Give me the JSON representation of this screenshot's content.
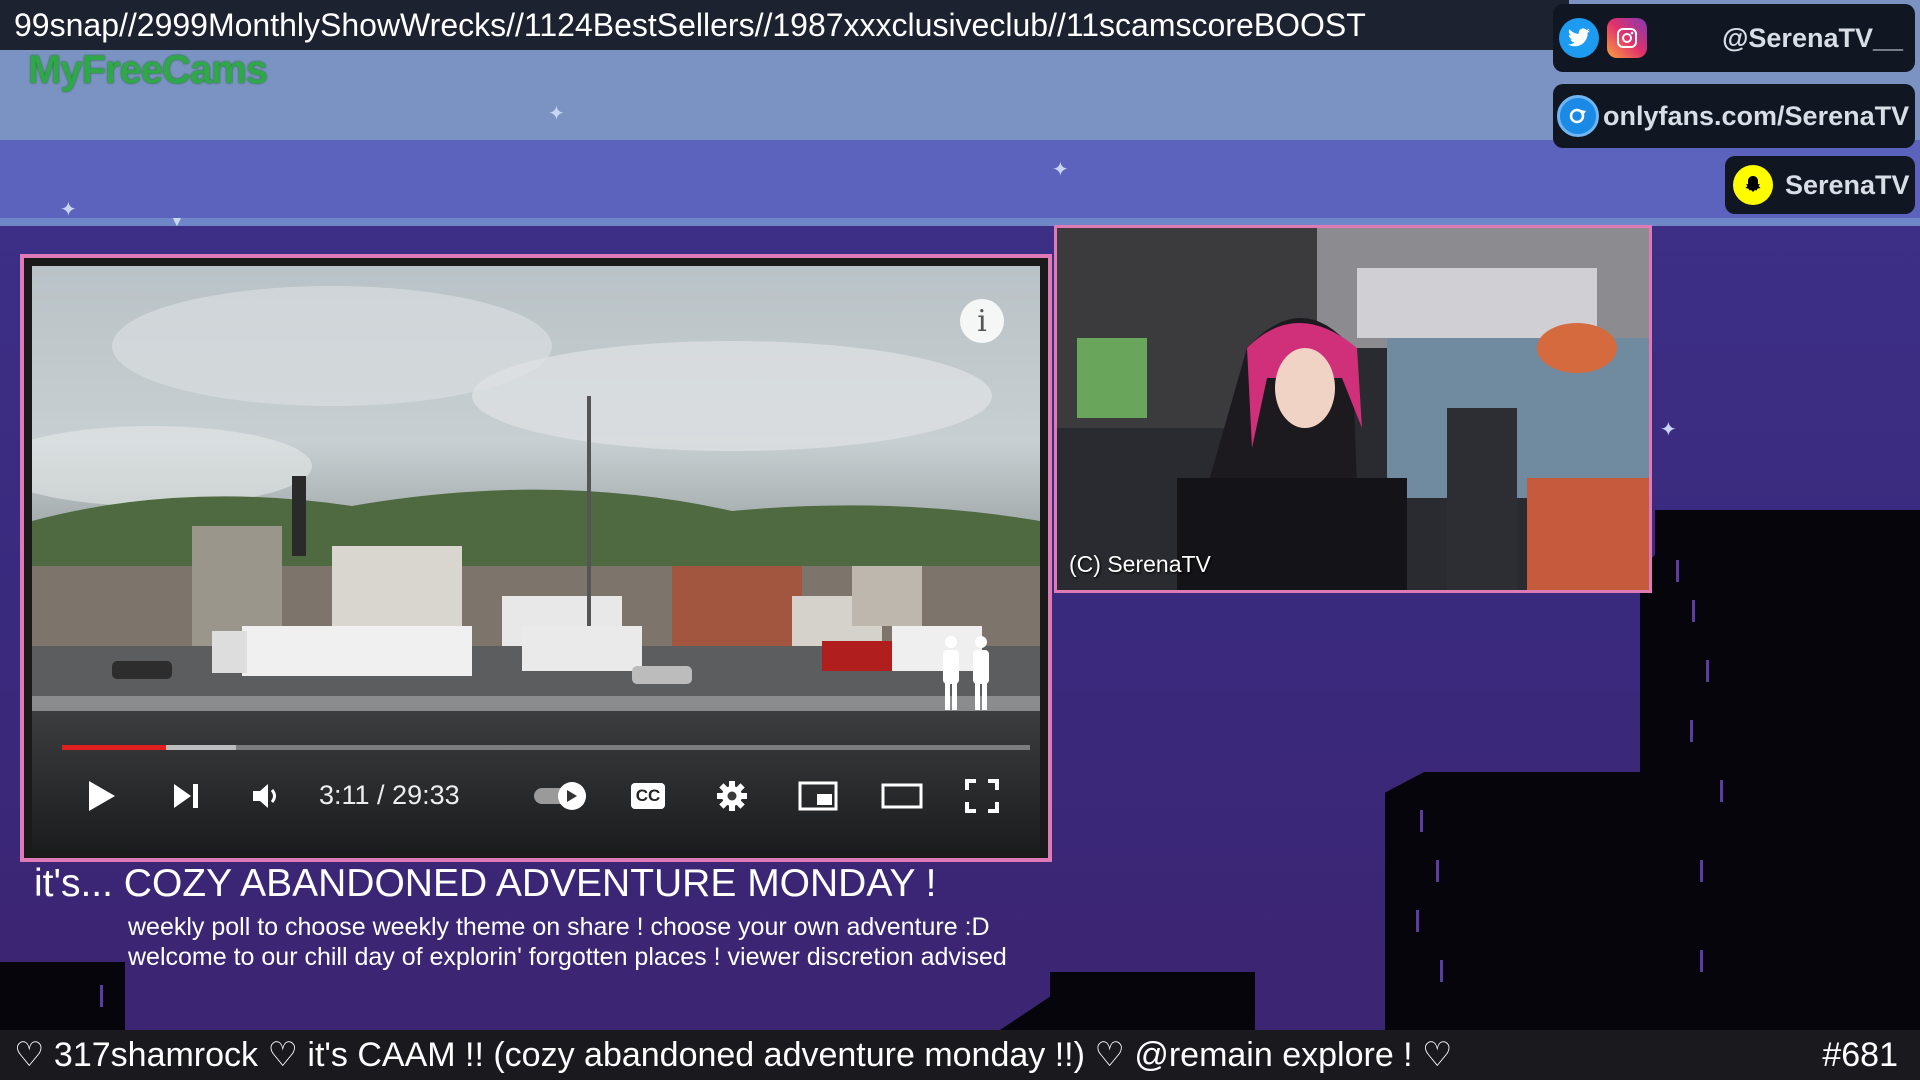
{
  "top_ticker": {
    "text": "99snap//2999MonthlyShowWrecks//1124BestSellers//1987xxxclusiveclub//11scamscoreBOOST"
  },
  "brand": {
    "name": "MyFreeCams"
  },
  "socials": [
    {
      "label": "@SerenaTV__",
      "icons": [
        "twitter-icon",
        "instagram-icon"
      ]
    },
    {
      "label": "onlyfans.com/SerenaTV",
      "icons": [
        "onlyfans-icon"
      ]
    },
    {
      "label": "SerenaTV",
      "icons": [
        "snapchat-icon"
      ]
    }
  ],
  "player": {
    "time_display": "3:11 / 29:33",
    "progress_fraction": 0.107,
    "buffered_fraction": 0.18,
    "controls": [
      "play-icon",
      "next-icon",
      "volume-icon",
      "autoplay-toggle",
      "cc-icon",
      "settings-icon",
      "miniplayer-icon",
      "theater-icon",
      "fullscreen-icon"
    ],
    "cc_label": "CC",
    "info_label": "i"
  },
  "caption": {
    "title": "it's... COZY ABANDONED ADVENTURE MONDAY !",
    "line1": "weekly poll to choose weekly theme on share ! choose your own adventure :D",
    "line2": "welcome to our chill day of explorin' forgotten places ! viewer discretion advised"
  },
  "webcam": {
    "label": "(C) SerenaTV"
  },
  "bottom_ticker": {
    "message": "♡ 317shamrock ♡ it's CAAM !! (cozy abandoned adventure monday !!) ♡ @remain explore ! ♡",
    "counter": "#681"
  },
  "colors": {
    "frame_pink": "#e07ab7",
    "progress_red": "#e02020",
    "brand_green": "#2fa84a"
  }
}
